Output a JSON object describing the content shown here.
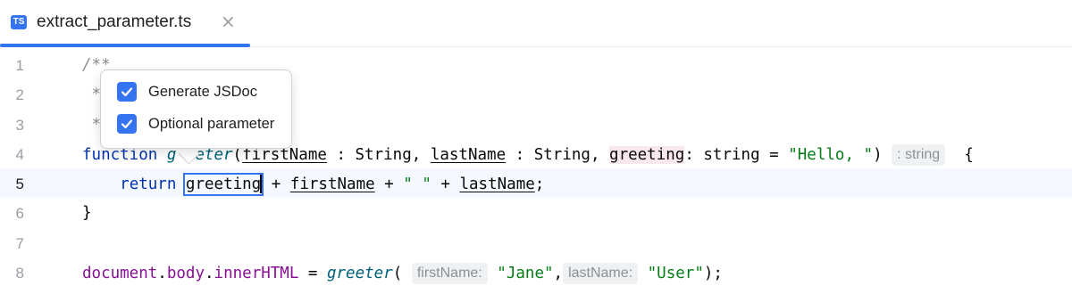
{
  "tab": {
    "icon_text": "TS",
    "filename": "extract_parameter.ts",
    "close_glyph": "×"
  },
  "gutter": {
    "line_numbers": [
      "1",
      "2",
      "3",
      "4",
      "5",
      "6",
      "7",
      "8"
    ],
    "current_line": "5"
  },
  "code": {
    "line1": "/**",
    "line2": " *",
    "line3": " *",
    "line4": {
      "kw_function": "function",
      "fn_name_visible": "g",
      "fn_name_rest": "eter",
      "paren_open": "(",
      "param1": "firstName",
      "sep1": " : String, ",
      "param2": "lastName",
      "sep2": " : String, ",
      "param3": "greeting",
      "sep3": ": string = ",
      "default_str": "\"Hello, \"",
      "paren_close": ")",
      "type_hint": ": string",
      "brace": "{"
    },
    "line5": {
      "kw_return": "return",
      "sel_word": "greeting",
      "plus1": " + ",
      "v1": "firstName",
      "plus2": " + ",
      "str_space": "\" \"",
      "plus3": " + ",
      "v2": "lastName",
      "semi": ";"
    },
    "line6": "}",
    "line8": {
      "obj": "document",
      "dot1": ".",
      "prop1": "body",
      "dot2": ".",
      "prop2": "innerHTML",
      "eq": " = ",
      "fn_call": "greeter",
      "paren_open": "(",
      "hint1": "firstName:",
      "arg1": "\"Jane\"",
      "comma": ",",
      "hint2": "lastName:",
      "arg2": "\"User\"",
      "close": ");"
    }
  },
  "popup": {
    "options": [
      {
        "label": "Generate JSDoc",
        "checked": true
      },
      {
        "label": "Optional parameter",
        "checked": true
      }
    ]
  },
  "colors": {
    "accent": "#3574f0",
    "keyword": "#0033b3",
    "string": "#067d17",
    "property": "#871094",
    "function": "#00627a"
  }
}
